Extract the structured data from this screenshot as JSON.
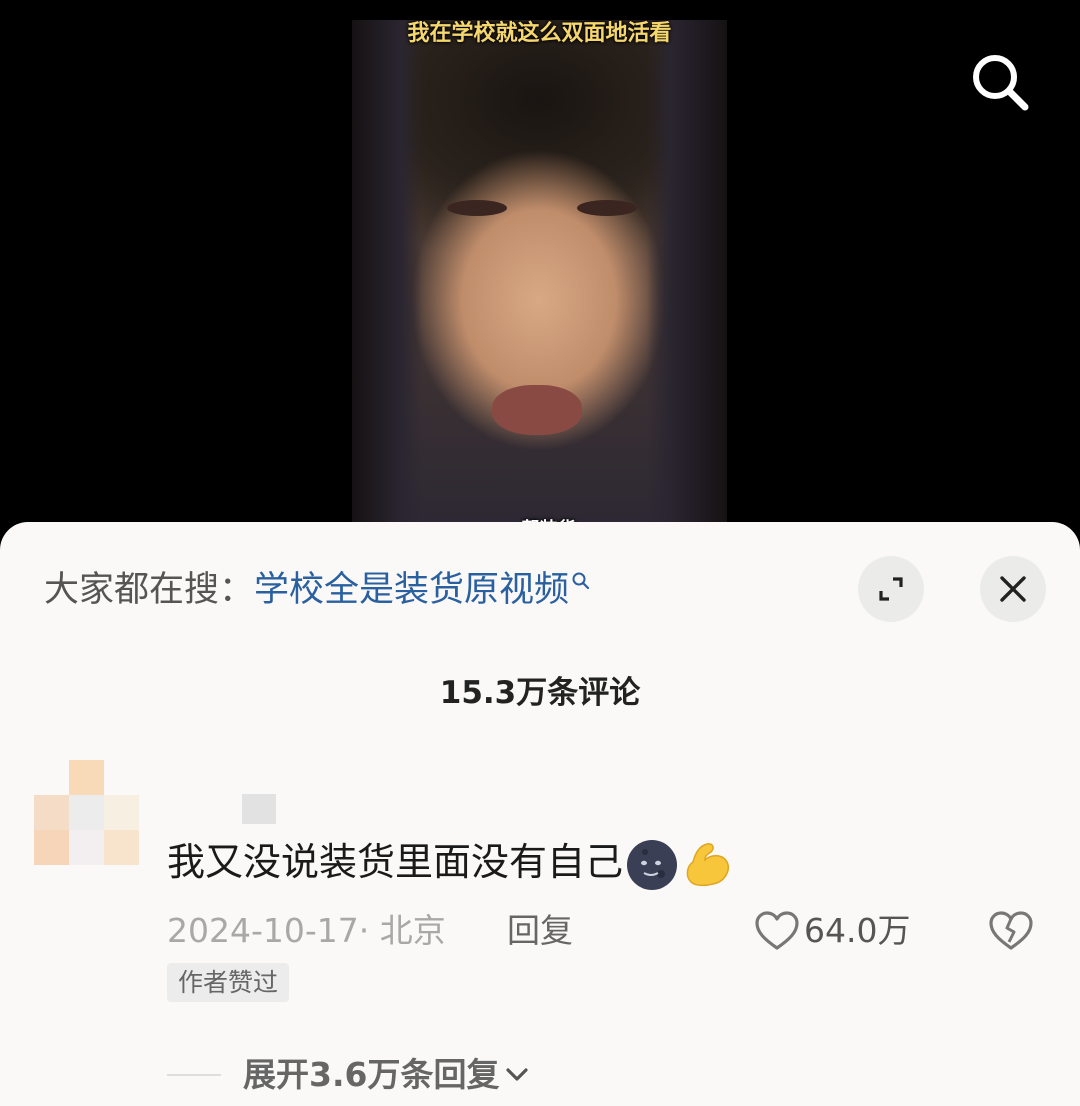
{
  "video": {
    "top_caption": "我在学校就这么双面地活看",
    "bottom_caption": "一帮装货"
  },
  "search_icon": "search-icon",
  "comments_panel": {
    "search_prefix": "大家都在搜：",
    "search_term": "学校全是装货原视频",
    "comment_count": "15.3万条评论",
    "expand_icon": "expand-icon",
    "close_icon": "close-icon"
  },
  "comment": {
    "text": "我又没说装货里面没有自己",
    "emojis": [
      "new-moon-face-emoji",
      "flexed-biceps-emoji"
    ],
    "meta": "2024-10-17· 北京",
    "reply_label": "回复",
    "like_count": "64.0万",
    "badge": "作者赞过",
    "expand_replies": "展开3.6万条回复"
  },
  "colors": {
    "link": "#2a5fa0",
    "sheet_bg": "#faf9f7",
    "caption_yellow": "#f5d76e"
  }
}
